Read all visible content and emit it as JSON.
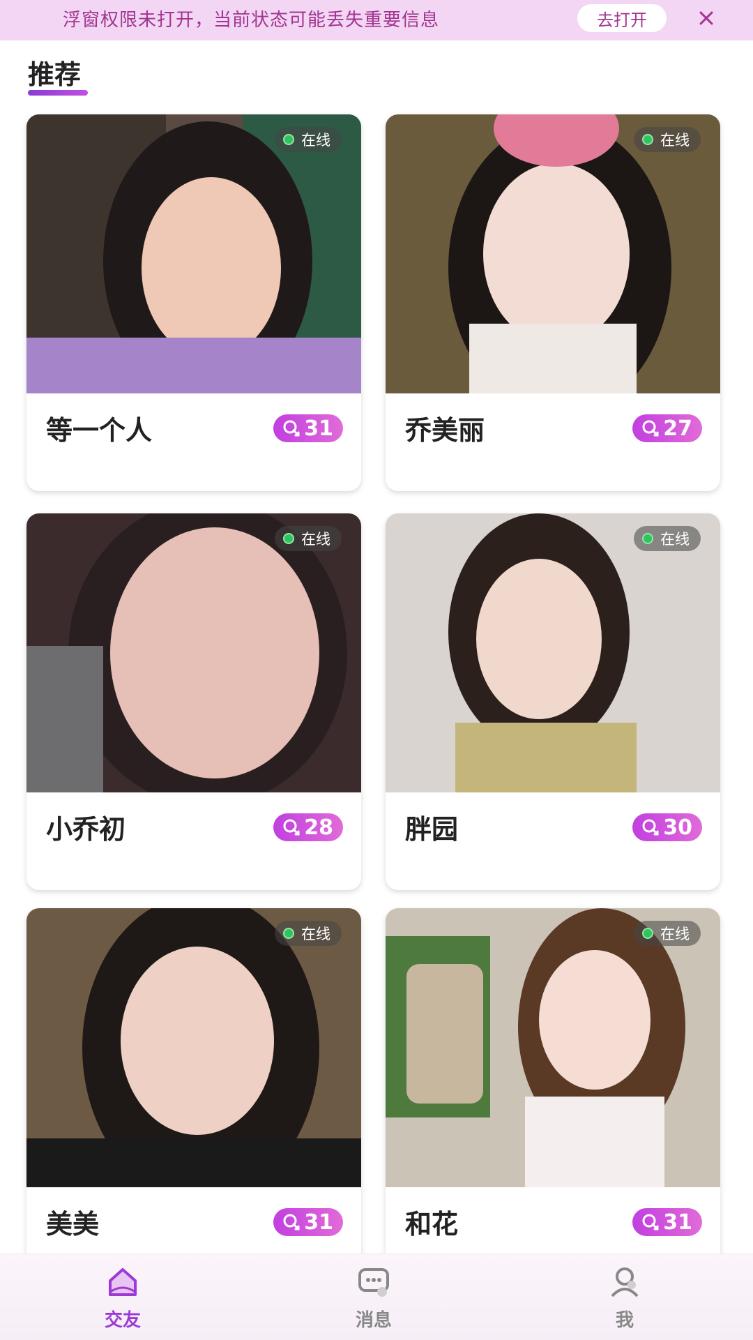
{
  "banner": {
    "text": "浮窗权限未打开，当前状态可能丢失重要信息",
    "button_label": "去打开",
    "close_icon": "close-icon"
  },
  "section": {
    "title": "推荐"
  },
  "cards": [
    {
      "name": "等一个人",
      "status": "在线",
      "count": "31"
    },
    {
      "name": "乔美丽",
      "status": "在线",
      "count": "27"
    },
    {
      "name": "小乔初",
      "status": "在线",
      "count": "28"
    },
    {
      "name": "胖园",
      "status": "在线",
      "count": "30"
    },
    {
      "name": "美美",
      "status": "在线",
      "count": "31"
    },
    {
      "name": "和花",
      "status": "在线",
      "count": "31"
    }
  ],
  "nav": {
    "items": [
      {
        "label": "交友",
        "icon": "home-icon",
        "active": true
      },
      {
        "label": "消息",
        "icon": "chat-icon",
        "active": false
      },
      {
        "label": "我",
        "icon": "profile-icon",
        "active": false
      }
    ]
  },
  "colors": {
    "accent": "#9b3ad8",
    "badge": "#c13fe0",
    "banner_bg": "#f2d6f4",
    "online_dot": "#2ec55c"
  }
}
